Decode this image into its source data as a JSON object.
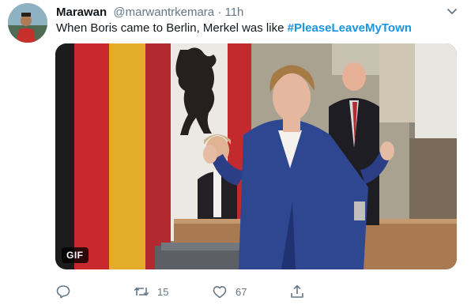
{
  "tweet": {
    "display_name": "Marawan",
    "handle": "@marwantrkemara",
    "separator": "·",
    "time": "11h",
    "text_plain": "When Boris came to Berlin, Merkel was like ",
    "hashtag": "#PleaseLeaveMyTown",
    "media_badge": "GIF",
    "retweets": "15",
    "likes": "67"
  },
  "icons": {
    "caret": "chevron-down-icon",
    "reply": "reply-icon",
    "retweet": "retweet-icon",
    "like": "heart-icon",
    "share": "share-icon"
  },
  "colors": {
    "hashtag": "#1b95e0",
    "muted": "#657786",
    "text": "#14171a"
  }
}
